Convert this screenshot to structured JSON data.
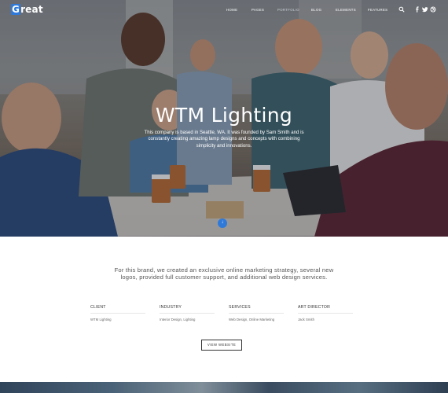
{
  "nav": {
    "logo_initial": "G",
    "logo_rest": "reat",
    "items": [
      {
        "label": "Home"
      },
      {
        "label": "Pages"
      },
      {
        "label": "Portfolio"
      },
      {
        "label": "Blog"
      },
      {
        "label": "Elements"
      },
      {
        "label": "Features"
      }
    ],
    "icons": [
      "search-icon",
      "facebook-icon",
      "twitter-icon",
      "dribbble-icon"
    ]
  },
  "hero": {
    "title": "WTM Lighting",
    "description": "This company is based in Seattle, WA. It was founded by Sam Smith and is constantly creating amazing lamp designs and concepts with combining simplicity and innovations.",
    "scroll_icon": "arrow-down-icon"
  },
  "project": {
    "intro": "For this brand, we created an exclusive online marketing strategy, several new logos, provided full customer support, and additional web design services.",
    "details": [
      {
        "heading": "Client",
        "value": "WTM Lighting"
      },
      {
        "heading": "Industry",
        "value": "Interior Design, Lighting"
      },
      {
        "heading": "Services",
        "value": "Web Design, Online Marketing"
      },
      {
        "heading": "Art Director",
        "value": "Jack Smith"
      }
    ],
    "button_label": "View Website"
  },
  "colors": {
    "accent": "#2f7ad9",
    "text": "#555555"
  }
}
